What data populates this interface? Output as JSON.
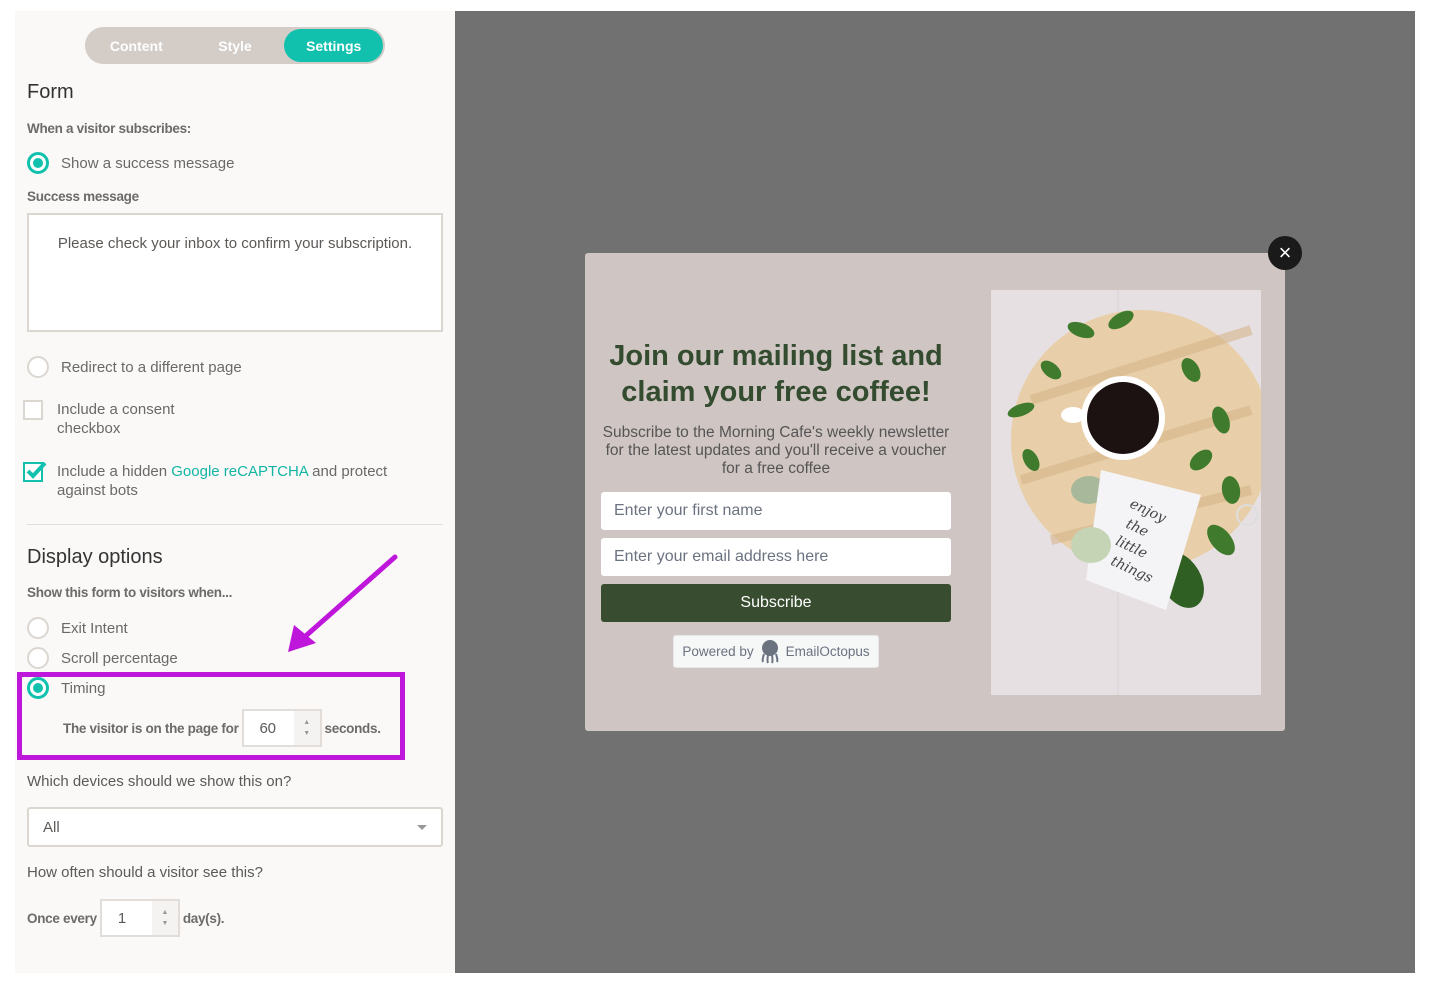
{
  "tabs": [
    {
      "label": "Content",
      "active": false
    },
    {
      "label": "Style",
      "active": false
    },
    {
      "label": "Settings",
      "active": true
    }
  ],
  "form": {
    "heading": "Form",
    "when_label": "When a visitor subscribes:",
    "option_success": "Show a success message",
    "success_label": "Success message",
    "success_message": "Please check your inbox to confirm your subscription.",
    "option_redirect": "Redirect to a different page",
    "consent_line1": "Include a consent",
    "consent_line2": "checkbox",
    "recaptcha_prefix": "Include a hidden ",
    "recaptcha_link": "Google reCAPTCHA",
    "recaptcha_suffix": " and protect",
    "recaptcha_line2": "against bots"
  },
  "display": {
    "heading": "Display options",
    "show_label": "Show this form to visitors when...",
    "option_exit": "Exit Intent",
    "option_scroll": "Scroll percentage",
    "option_timing": "Timing",
    "timing_prefix": "The visitor is on the page for",
    "timing_value": "60",
    "timing_suffix": "seconds.",
    "devices_question": "Which devices should we show this on?",
    "devices_value": "All",
    "frequency_question": "How often should a visitor see this?",
    "frequency_prefix": "Once every",
    "frequency_value": "1",
    "frequency_suffix": "day(s)."
  },
  "popup": {
    "title": "Join our mailing list and claim your free coffee!",
    "subtitle": "Subscribe to the Morning Cafe's weekly newsletter for the latest updates and you'll receive a voucher for a free coffee",
    "first_name_placeholder": "Enter your first name",
    "email_placeholder": "Enter your email address here",
    "subscribe_label": "Subscribe",
    "powered_by": "Powered by",
    "brand": "EmailOctopus",
    "close_icon": "×",
    "image_alt": "Coffee cup with leaves and 'enjoy the little things' note"
  },
  "colors": {
    "accent": "#12c1ad",
    "highlight": "#bf16db",
    "popup_bg": "#cfc5c2",
    "popup_title": "#334b2f",
    "button": "#384d30",
    "preview_bg": "#717171"
  }
}
